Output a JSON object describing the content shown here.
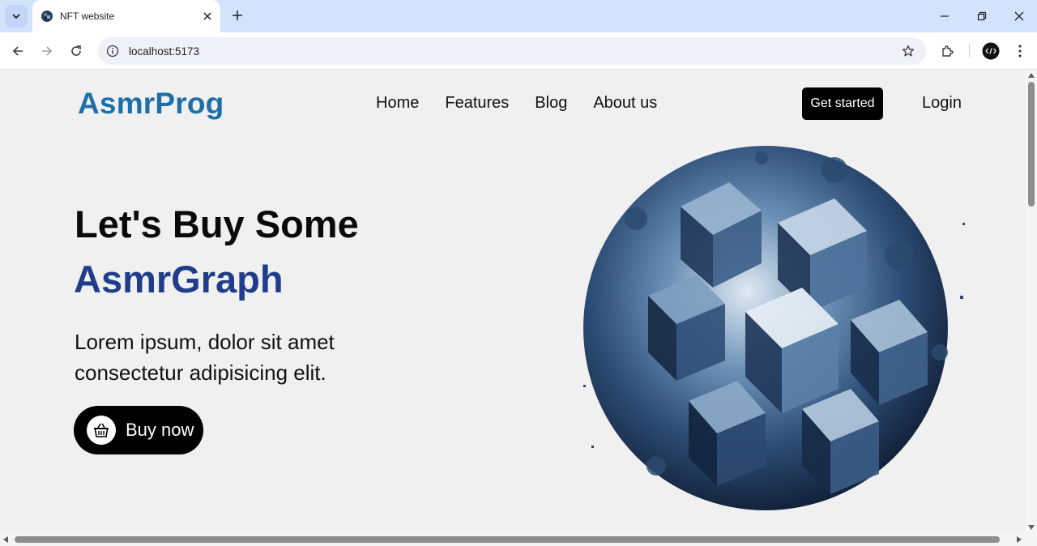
{
  "browser": {
    "tab_title": "NFT website",
    "url": "localhost:5173",
    "colors": {
      "tabbar": "#d3e3fd",
      "toolbar": "#ffffff"
    }
  },
  "site": {
    "logo": "AsmrProg",
    "nav": [
      "Home",
      "Features",
      "Blog",
      "About us"
    ],
    "get_started": "Get started",
    "login": "Login",
    "hero": {
      "line1": "Let's Buy Some",
      "line2": "AsmrGraph",
      "description": "Lorem ipsum, dolor sit amet consectetur adipisicing elit.",
      "cta": "Buy now"
    },
    "colors": {
      "logo": "#1c6fa8",
      "accent": "#1f3d8a",
      "button": "#000000",
      "background": "#f0f0f0"
    },
    "hero_image": "abstract-blue-cube-sphere"
  }
}
